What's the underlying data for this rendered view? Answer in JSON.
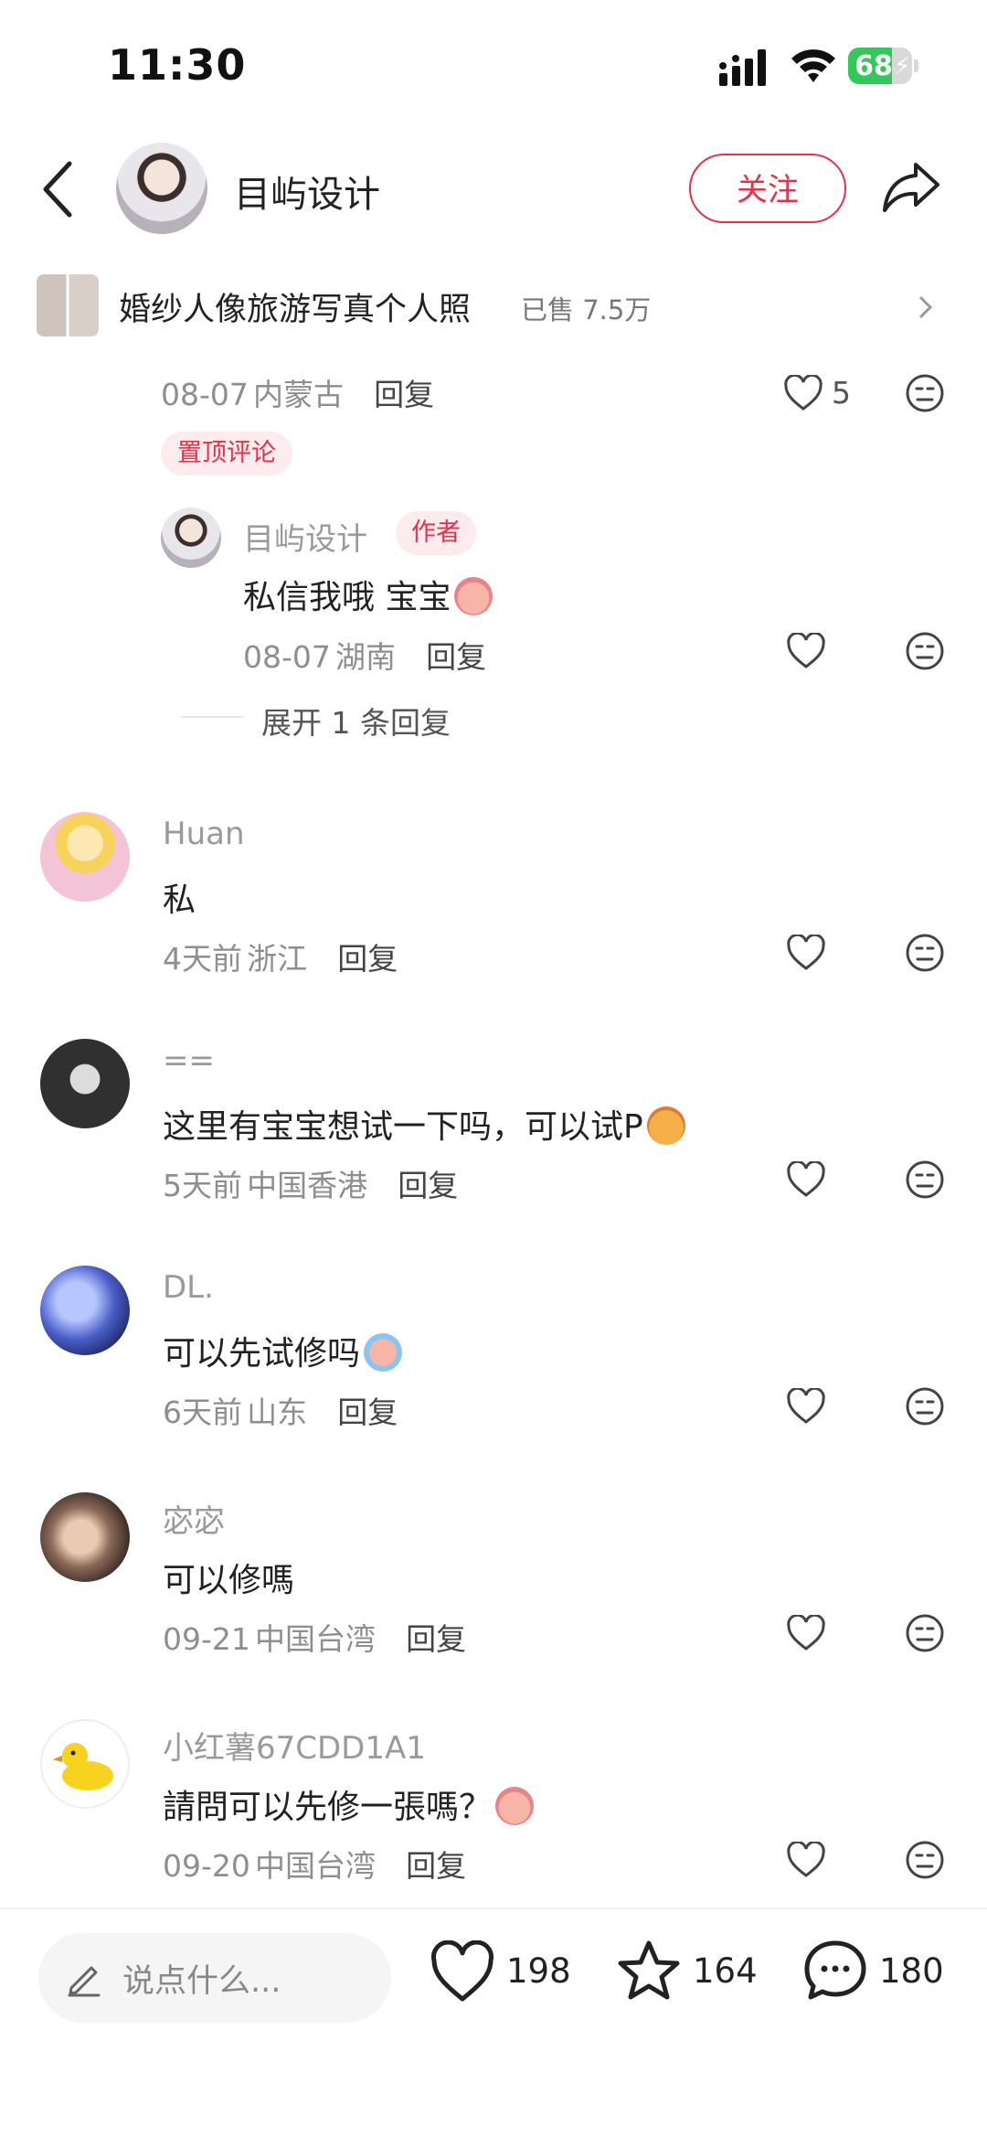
{
  "status": {
    "time": "11:30",
    "battery": "68",
    "battery_level": 0.68
  },
  "header": {
    "name": "目屿设计",
    "follow_label": "关注"
  },
  "product": {
    "title": "婚纱人像旅游写真个人照",
    "sold": "已售 7.5万"
  },
  "pinned": {
    "meta_date": "08-07",
    "meta_loc": "内蒙古",
    "reply_label": "回复",
    "likes": "5",
    "pin_label": "置顶评论",
    "sub_reply": {
      "name": "目屿设计",
      "author_badge": "作者",
      "text": "私信我哦 宝宝",
      "meta_date": "08-07",
      "meta_loc": "湖南",
      "reply_label": "回复"
    },
    "expand_label": "展开 1 条回复"
  },
  "comments": [
    {
      "name": "Huan",
      "text": "私",
      "date": "4天前",
      "loc": "浙江",
      "reply": "回复"
    },
    {
      "name": "==",
      "text": "这里有宝宝想试一下吗，可以试P",
      "date": "5天前",
      "loc": "中国香港",
      "reply": "回复"
    },
    {
      "name": "DL.",
      "text": "可以先试修吗",
      "date": "6天前",
      "loc": "山东",
      "reply": "回复"
    },
    {
      "name": "宓宓",
      "text": "可以修嗎",
      "date": "09-21",
      "loc": "中国台湾",
      "reply": "回复"
    },
    {
      "name": "小红薯67CDD1A1",
      "text": "請問可以先修一張嗎？",
      "date": "09-20",
      "loc": "中国台湾",
      "reply": "回复"
    }
  ],
  "bottom": {
    "placeholder": "说点什么...",
    "likes": "198",
    "stars": "164",
    "comments": "180"
  },
  "colors": {
    "accent": "#e3324a",
    "battery": "#34c759"
  }
}
